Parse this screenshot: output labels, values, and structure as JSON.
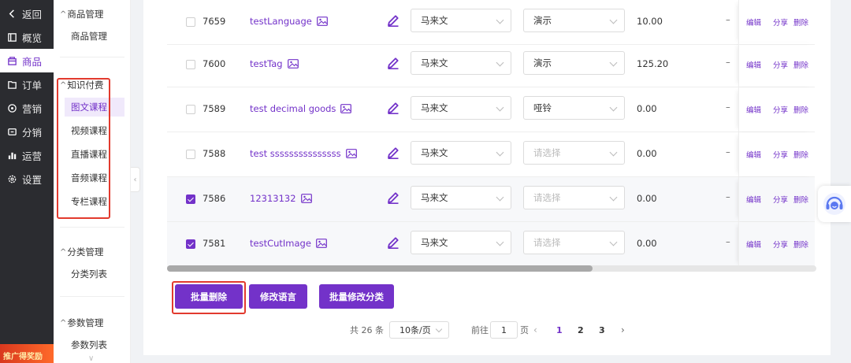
{
  "sidebar": {
    "items": [
      {
        "label": "返回",
        "icon": "chevron-left-icon"
      },
      {
        "label": "概览",
        "icon": "overview-icon"
      },
      {
        "label": "商品",
        "icon": "goods-icon"
      },
      {
        "label": "订单",
        "icon": "order-icon"
      },
      {
        "label": "营销",
        "icon": "marketing-icon"
      },
      {
        "label": "分销",
        "icon": "distribution-icon"
      },
      {
        "label": "运营",
        "icon": "operation-chart-icon"
      },
      {
        "label": "设置",
        "icon": "settings-gear-icon"
      }
    ],
    "promo": "推广得奖励"
  },
  "subnav": {
    "goods_group": "商品管理",
    "goods_item": "商品管理",
    "knowledge_group": "知识付费",
    "knowledge_items": [
      "图文课程",
      "视频课程",
      "直播课程",
      "音频课程",
      "专栏课程"
    ],
    "category_group": "分类管理",
    "category_item": "分类列表",
    "param_group": "参数管理",
    "param_item": "参数列表"
  },
  "table": {
    "rows": [
      {
        "id": "7659",
        "name": "testLanguage",
        "language": "马来文",
        "category": "演示",
        "price": "10.00",
        "extra": "–",
        "checked": false
      },
      {
        "id": "7600",
        "name": "testTag",
        "language": "马来文",
        "category": "演示",
        "price": "125.20",
        "extra": "–",
        "checked": false
      },
      {
        "id": "7589",
        "name": "test decimal goods",
        "language": "马来文",
        "category": "哑铃",
        "price": "0.00",
        "extra": "–",
        "checked": false
      },
      {
        "id": "7588",
        "name": "test sssssssssssssss",
        "language": "马来文",
        "category": "请选择",
        "price": "0.00",
        "extra": "–",
        "checked": false
      },
      {
        "id": "7586",
        "name": "12313132",
        "language": "马来文",
        "category": "请选择",
        "price": "0.00",
        "extra": "–",
        "checked": true
      },
      {
        "id": "7581",
        "name": "testCutImage",
        "language": "马来文",
        "category": "请选择",
        "price": "0.00",
        "extra": "–",
        "checked": true
      }
    ],
    "ops": {
      "edit": "编辑",
      "share": "分享",
      "delete": "删除"
    },
    "category_placeholder": "请选择"
  },
  "actions": {
    "batch_delete": "批量删除",
    "change_language": "修改语言",
    "batch_change_category": "批量修改分类"
  },
  "pagination": {
    "total": "共 26 条",
    "page_size": "10条/页",
    "goto_label": "前往",
    "goto_value": "1",
    "page_unit": "页",
    "pages": [
      "1",
      "2",
      "3"
    ],
    "current": "1"
  },
  "colors": {
    "accent": "#7332c9",
    "sidebar_bg": "#2b2c30",
    "highlight_box": "#e23a2e"
  }
}
